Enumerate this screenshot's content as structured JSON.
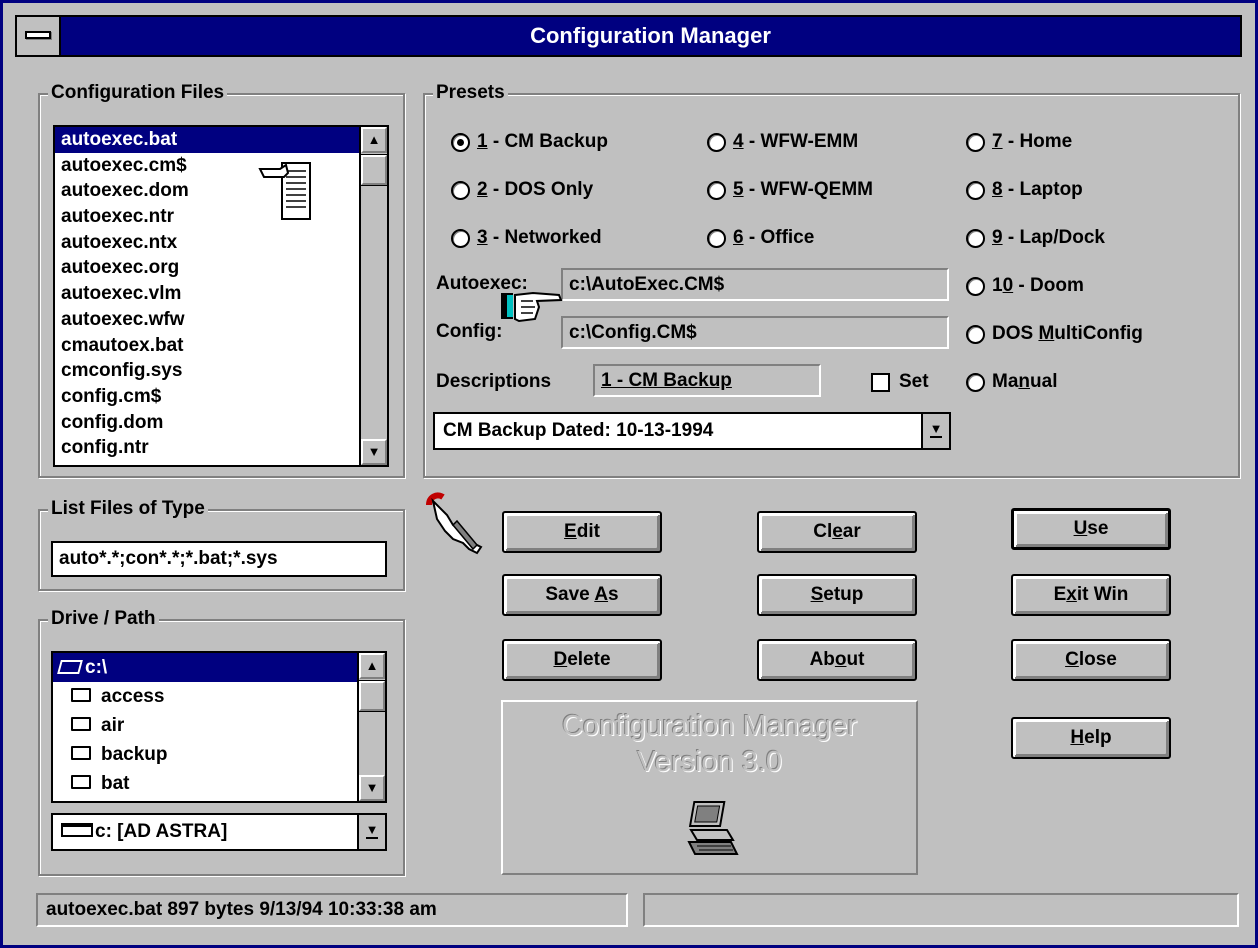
{
  "window": {
    "title": "Configuration Manager"
  },
  "config_files": {
    "label": "Configuration Files",
    "items": [
      "autoexec.bat",
      "autoexec.cm$",
      "autoexec.dom",
      "autoexec.ntr",
      "autoexec.ntx",
      "autoexec.org",
      "autoexec.vlm",
      "autoexec.wfw",
      "cmautoex.bat",
      "cmconfig.sys",
      "config.cm$",
      "config.dom",
      "config.ntr"
    ],
    "selected": "autoexec.bat"
  },
  "presets": {
    "label": "Presets",
    "options": [
      {
        "num": "1",
        "rest": " - CM Backup",
        "checked": true
      },
      {
        "num": "2",
        "rest": " - DOS Only",
        "checked": false
      },
      {
        "num": "3",
        "rest": " - Networked",
        "checked": false
      },
      {
        "num": "4",
        "rest": " - WFW-EMM",
        "checked": false
      },
      {
        "num": "5",
        "rest": " - WFW-QEMM",
        "checked": false
      },
      {
        "num": "6",
        "rest": " - Office",
        "checked": false
      },
      {
        "num": "7",
        "rest": " - Home",
        "checked": false
      },
      {
        "num": "8",
        "rest": " - Laptop",
        "checked": false
      },
      {
        "num": "9",
        "rest": " - Lap/Dock",
        "checked": false
      },
      {
        "num": "10",
        "rest": " - Doom",
        "checked": false,
        "ul": "0",
        "pre": "1"
      },
      {
        "label_pre": "DOS ",
        "label_ul": "M",
        "label_post": "ultiConfig",
        "checked": false
      },
      {
        "label_pre": "Ma",
        "label_ul": "n",
        "label_post": "ual",
        "checked": false
      }
    ],
    "autoexec_label": "Autoexec:",
    "autoexec_value": "c:\\AutoExec.CM$",
    "config_label": "Config:",
    "config_value": "c:\\Config.CM$",
    "descriptions_label": "Descriptions",
    "description_value": "1 - CM Backup",
    "set_label": "Set",
    "dropdown_value": "CM Backup Dated: 10-13-1994"
  },
  "list_files_type": {
    "label": "List Files of Type",
    "value": "auto*.*;con*.*;*.bat;*.sys"
  },
  "drive_path": {
    "label": "Drive / Path",
    "items": [
      "c:\\",
      "access",
      "air",
      "backup",
      "bat"
    ],
    "drive_value": "c: [AD ASTRA]"
  },
  "buttons": {
    "edit": {
      "ul": "E",
      "rest": "dit"
    },
    "save_as": {
      "pre": "Save ",
      "ul": "A",
      "rest": "s"
    },
    "delete": {
      "ul": "D",
      "rest": "elete"
    },
    "clear": {
      "pre": "Cl",
      "ul": "e",
      "rest": "ar"
    },
    "setup": {
      "ul": "S",
      "rest": "etup"
    },
    "about": {
      "pre": "Ab",
      "ul": "o",
      "rest": "ut"
    },
    "use": {
      "ul": "U",
      "rest": "se"
    },
    "exit_win": {
      "pre": "E",
      "ul": "x",
      "rest": "it Win"
    },
    "close": {
      "ul": "C",
      "rest": "lose"
    },
    "help": {
      "ul": "H",
      "rest": "elp"
    }
  },
  "logo": {
    "line1": "Configuration Manager",
    "line2": "Version 3.0"
  },
  "status": {
    "left": "autoexec.bat  897 bytes 9/13/94 10:33:38 am",
    "right": ""
  },
  "icons": [
    "system-menu-icon",
    "document-icon",
    "pointing-hand-icon",
    "hand-with-pen-icon",
    "computer-icon",
    "folder-icon",
    "open-folder-icon",
    "drive-icon",
    "scroll-up-icon",
    "scroll-down-icon",
    "dropdown-arrow-icon"
  ]
}
